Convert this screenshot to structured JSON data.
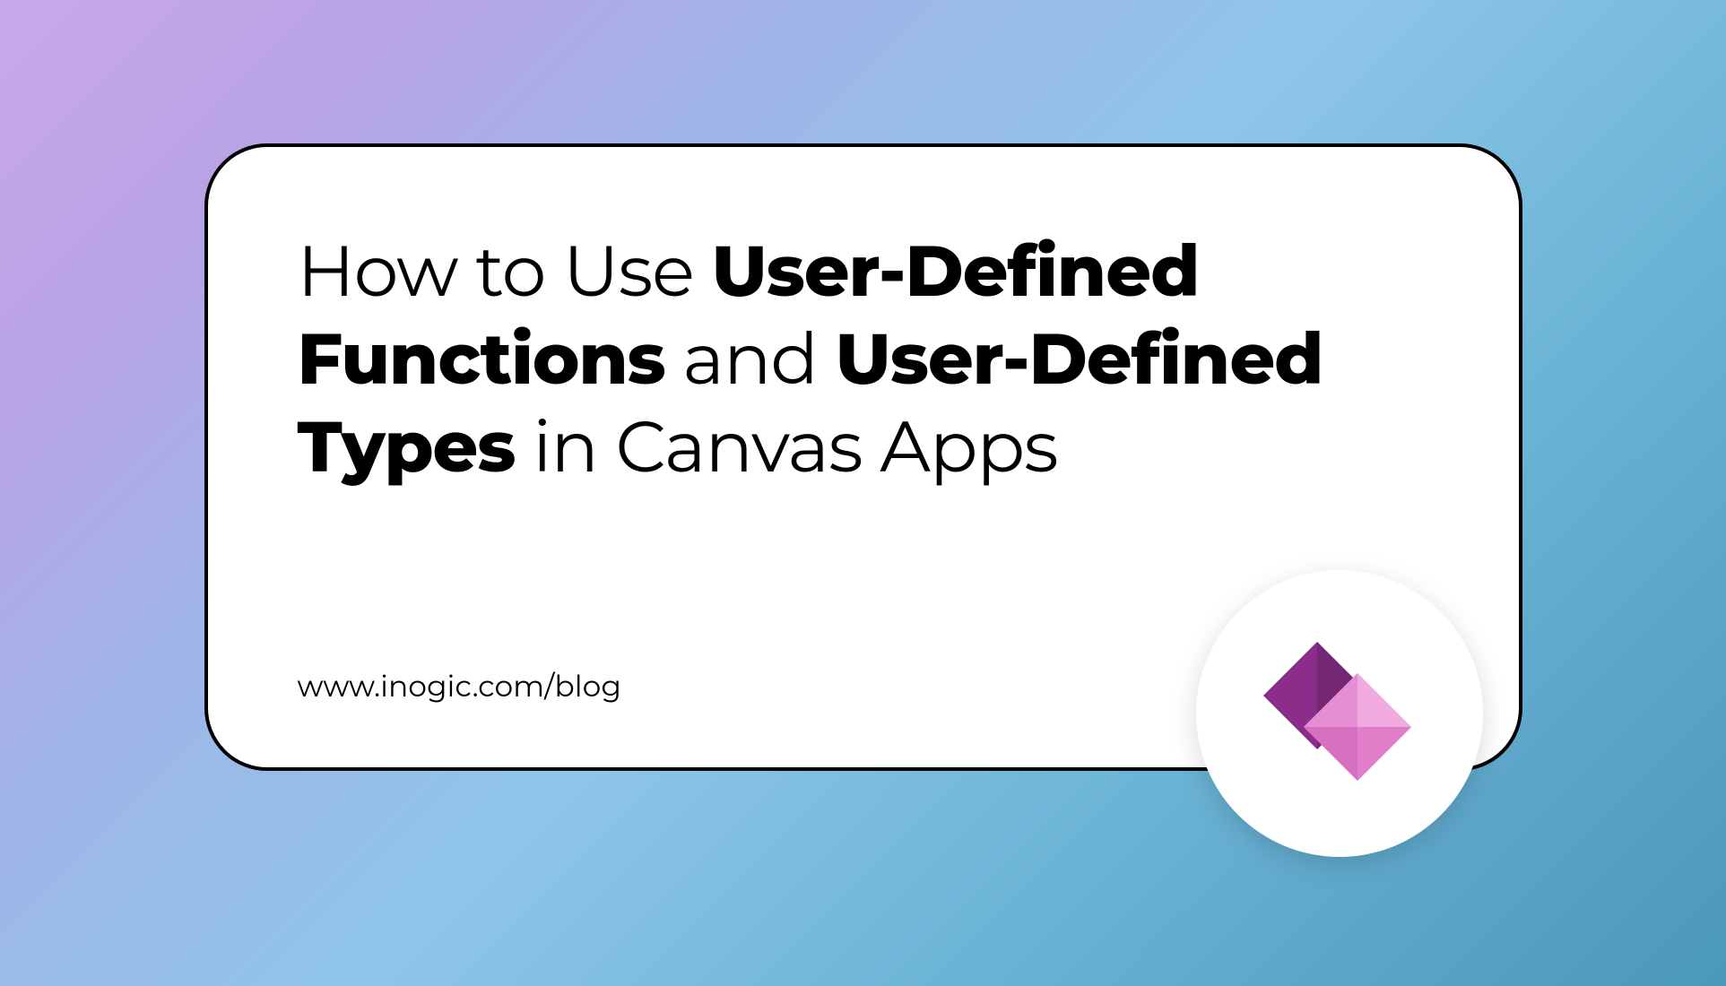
{
  "title": {
    "part1": "How to Use ",
    "part2": "User-Defined Functions",
    "part3": " and ",
    "part4": "User-Defined Types",
    "part5": " in Canvas Apps"
  },
  "url": "www.inogic.com/blog",
  "logo": {
    "name": "power-apps-icon"
  }
}
